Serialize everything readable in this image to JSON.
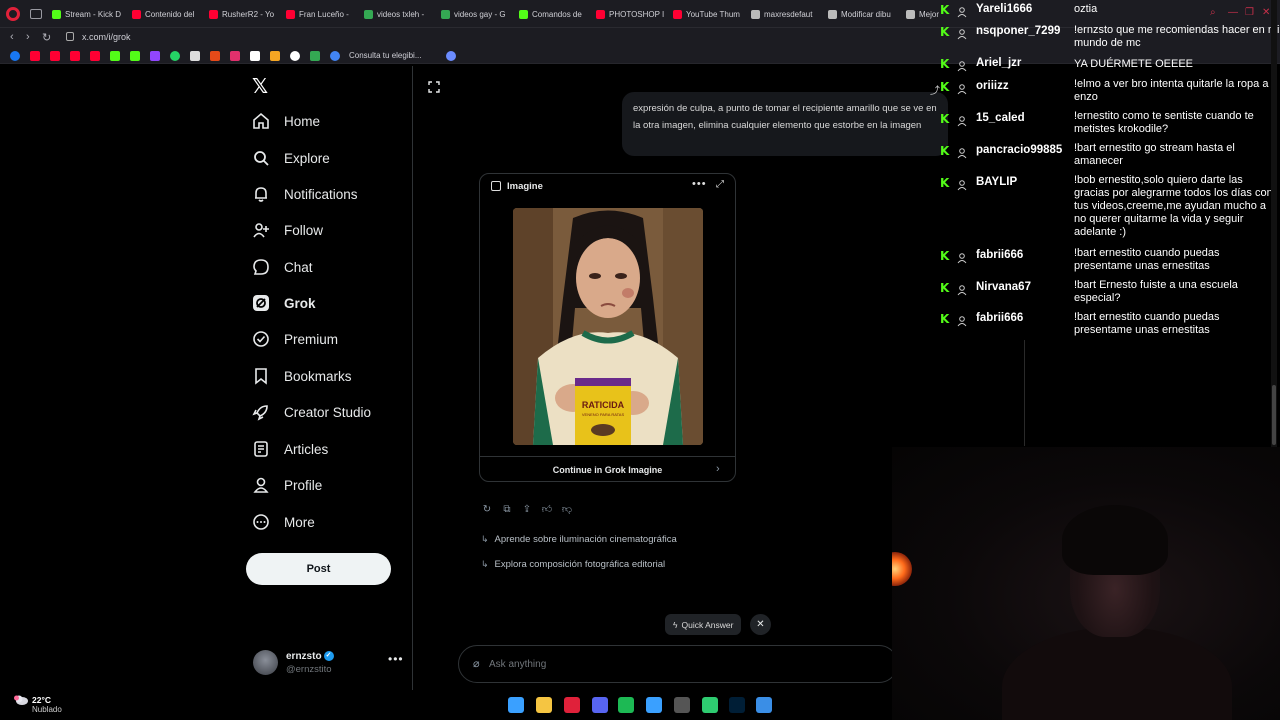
{
  "browser": {
    "tabs": [
      {
        "label": "Stream - Kick D",
        "color": "#53fc18"
      },
      {
        "label": "Contenido del",
        "color": "#ff0033"
      },
      {
        "label": "RusherR2 - Yo",
        "color": "#ff0033"
      },
      {
        "label": "Fran Luceño -",
        "color": "#ff0033"
      },
      {
        "label": "videos txleh - ",
        "color": "#34a853"
      },
      {
        "label": "videos gay - G",
        "color": "#34a853"
      },
      {
        "label": "Comandos de",
        "color": "#53fc18"
      },
      {
        "label": "PHOTOSHOP I",
        "color": "#ff0033"
      },
      {
        "label": "YouTube Thum",
        "color": "#ff0033"
      },
      {
        "label": "maxresdefaut",
        "color": "#bbbbbb"
      },
      {
        "label": "Modificar dibu",
        "color": "#bbbbbb"
      },
      {
        "label": "Mejor",
        "color": "#bbbbbb"
      }
    ],
    "url": "x.com/i/grok",
    "bookmarks_text": "Consulta tu elegibi..."
  },
  "nav": {
    "items": [
      {
        "label": "Home",
        "icon": "home-icon"
      },
      {
        "label": "Explore",
        "icon": "search-icon"
      },
      {
        "label": "Notifications",
        "icon": "bell-icon"
      },
      {
        "label": "Follow",
        "icon": "follow-icon"
      },
      {
        "label": "Chat",
        "icon": "chat-icon"
      },
      {
        "label": "Grok",
        "icon": "grok-icon"
      },
      {
        "label": "Premium",
        "icon": "premium-icon"
      },
      {
        "label": "Bookmarks",
        "icon": "bookmark-icon"
      },
      {
        "label": "Creator Studio",
        "icon": "rocket-icon"
      },
      {
        "label": "Articles",
        "icon": "articles-icon"
      },
      {
        "label": "Profile",
        "icon": "profile-icon"
      },
      {
        "label": "More",
        "icon": "more-icon"
      }
    ],
    "post_label": "Post"
  },
  "account": {
    "name": "ernzsto",
    "handle": "@ernzstito"
  },
  "conversation": {
    "prompt_text": "expresión de culpa, a punto de tomar el recipiente amarillo que se ve en la otra imagen, elimina cualquier elemento que estorbe en la imagen",
    "card_title": "Imagine",
    "can_label_1": "RATICIDA",
    "can_label_2": "VENENO PARA RATAS",
    "card_footer": "Continue in Grok Imagine",
    "suggestions": [
      "Aprende sobre iluminación cinematográfica",
      "Explora composición fotográfica editorial"
    ],
    "quick_answer": "Quick Answer",
    "ask_placeholder": "Ask anything"
  },
  "chat": {
    "messages": [
      {
        "user": "Yareli1666",
        "text": "oztia"
      },
      {
        "user": "nsqponer_7299",
        "text": "!ernzsto que me recomiendas hacer en mi mundo de mc"
      },
      {
        "user": "Ariel_jzr",
        "text": "YA DUÉRMETE OEEEE"
      },
      {
        "user": "oriiizz",
        "text": "!elmo a ver bro intenta quitarle la ropa a enzo"
      },
      {
        "user": "15_caled",
        "text": "!ernestito como te sentiste cuando te metistes krokodile?"
      },
      {
        "user": "pancracio99885",
        "text": "!bart ernestito go stream hasta el amanecer"
      },
      {
        "user": "BAYLIP",
        "text": "!bob ernestito,solo quiero darte las gracias por alegrarme todos los días con tus videos,creeme,me ayudan mucho a no querer quitarme la vida y seguir adelante :)"
      },
      {
        "user": "fabrii666",
        "text": "!bart ernestito cuando puedas presentame unas ernestitas"
      },
      {
        "user": "Nirvana67",
        "text": "!bart Ernesto fuiste a una escuela especial?"
      },
      {
        "user": "fabrii666",
        "text": "!bart ernestito cuando puedas presentame unas ernestitas"
      }
    ]
  },
  "taskbar": {
    "temperature": "22°C",
    "weather": "Nublado",
    "apps": [
      {
        "name": "windows-start-icon",
        "color": "#3aa0ff"
      },
      {
        "name": "file-explorer-icon",
        "color": "#f5c542"
      },
      {
        "name": "opera-icon",
        "color": "#e0213a"
      },
      {
        "name": "discord-icon",
        "color": "#5865f2"
      },
      {
        "name": "spotify-icon",
        "color": "#1db954"
      },
      {
        "name": "browser-icon",
        "color": "#3aa0ff"
      },
      {
        "name": "obs-icon",
        "color": "#555555"
      },
      {
        "name": "app-icon",
        "color": "#2ecc71"
      },
      {
        "name": "photoshop-icon",
        "color": "#001e36"
      },
      {
        "name": "image-viewer-icon",
        "color": "#3a8ee6"
      }
    ]
  },
  "colors": {
    "kick_green": "#53fc18",
    "x_blue": "#1d9bf0",
    "background": "#000000"
  }
}
